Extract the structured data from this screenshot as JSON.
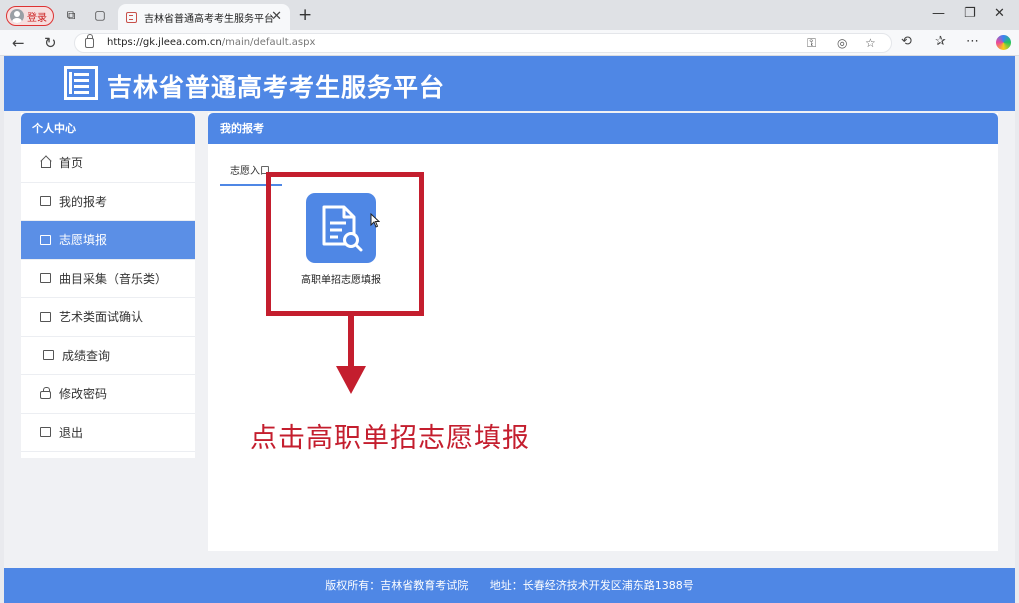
{
  "browser": {
    "login_label": "登录",
    "tab_title": "吉林省普通高考考生服务平台",
    "url_host": "https://gk.jleea.com.cn",
    "url_path": "/main/default.aspx"
  },
  "header": {
    "title": "吉林省普通高考考生服务平台"
  },
  "sidebar": {
    "title": "个人中心",
    "items": [
      {
        "label": "首页",
        "icon": "home-icon"
      },
      {
        "label": "我的报考",
        "icon": "list-icon"
      },
      {
        "label": "志愿填报",
        "icon": "form-icon",
        "active": true
      },
      {
        "label": "曲目采集（音乐类）",
        "icon": "checklist-icon"
      },
      {
        "label": "艺术类面试确认",
        "icon": "clipboard-icon"
      },
      {
        "label": "成绩查询",
        "icon": "report-icon"
      },
      {
        "label": "修改密码",
        "icon": "lock-icon"
      },
      {
        "label": "退出",
        "icon": "logout-icon"
      }
    ]
  },
  "main": {
    "title": "我的报考",
    "tab_label": "志愿入口",
    "tile_label": "高职单招志愿填报"
  },
  "annotation": {
    "instruction": "点击高职单招志愿填报",
    "color": "#c41e2e"
  },
  "footer": {
    "copyright": "版权所有：吉林省教育考试院",
    "address": "地址：长春经济技术开发区浦东路1388号"
  },
  "colors": {
    "brand": "#4f87e5"
  }
}
